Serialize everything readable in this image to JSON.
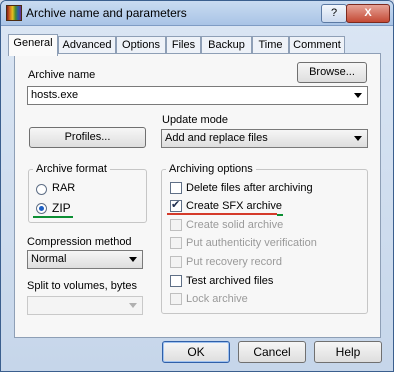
{
  "window": {
    "title": "Archive name and parameters",
    "help_button": "?",
    "close_button": "X"
  },
  "tabs": [
    "General",
    "Advanced",
    "Options",
    "Files",
    "Backup",
    "Time",
    "Comment"
  ],
  "active_tab": "General",
  "archive_name": {
    "label": "Archive name",
    "value": "hosts.exe",
    "browse_button": "Browse..."
  },
  "profiles_button": "Profiles...",
  "update_mode": {
    "label": "Update mode",
    "value": "Add and replace files"
  },
  "archive_format": {
    "title": "Archive format",
    "options": [
      {
        "label": "RAR",
        "selected": false
      },
      {
        "label": "ZIP",
        "selected": true
      }
    ]
  },
  "compression_method": {
    "label": "Compression method",
    "value": "Normal"
  },
  "split_volumes": {
    "label": "Split to volumes, bytes",
    "value": ""
  },
  "archiving_options": {
    "title": "Archiving options",
    "items": [
      {
        "label": "Delete files after archiving",
        "checked": false,
        "enabled": true
      },
      {
        "label": "Create SFX archive",
        "checked": true,
        "enabled": true
      },
      {
        "label": "Create solid archive",
        "checked": false,
        "enabled": false
      },
      {
        "label": "Put authenticity verification",
        "checked": false,
        "enabled": false
      },
      {
        "label": "Put recovery record",
        "checked": false,
        "enabled": false
      },
      {
        "label": "Test archived files",
        "checked": false,
        "enabled": true
      },
      {
        "label": "Lock archive",
        "checked": false,
        "enabled": false
      }
    ]
  },
  "footer": {
    "ok": "OK",
    "cancel": "Cancel",
    "help": "Help"
  },
  "annotation_colors": {
    "sfx_underline": "#d43a2a",
    "zip_underline": "#0c8f33"
  }
}
